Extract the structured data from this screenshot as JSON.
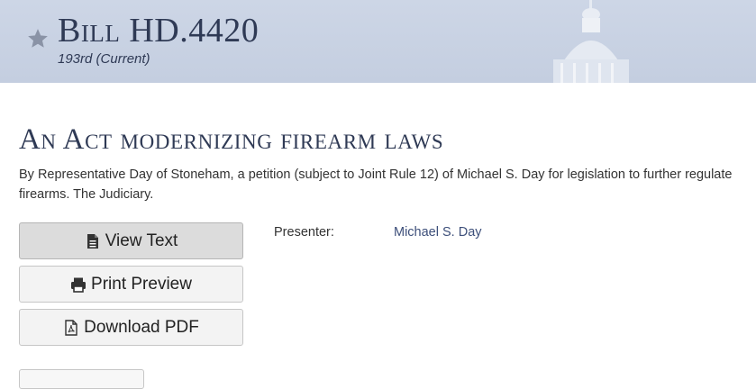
{
  "header": {
    "bill_title": "Bill HD.4420",
    "session": "193rd (Current)"
  },
  "main": {
    "act_title": "An Act modernizing firearm laws",
    "summary": "By Representative Day of Stoneham, a petition (subject to Joint Rule 12) of Michael S. Day for legislation to further regulate firearms. The Judiciary."
  },
  "actions": {
    "view_text": "View Text",
    "print_preview": "Print Preview",
    "download_pdf": "Download PDF"
  },
  "details": {
    "presenter_label": "Presenter:",
    "presenter_name": "Michael S. Day"
  },
  "icons": {
    "star": "star-icon",
    "document": "document-icon",
    "print": "print-icon",
    "pdf": "pdf-icon"
  },
  "colors": {
    "banner": "#c4cee0",
    "heading": "#2f3a55",
    "link": "#3d4f7a"
  }
}
